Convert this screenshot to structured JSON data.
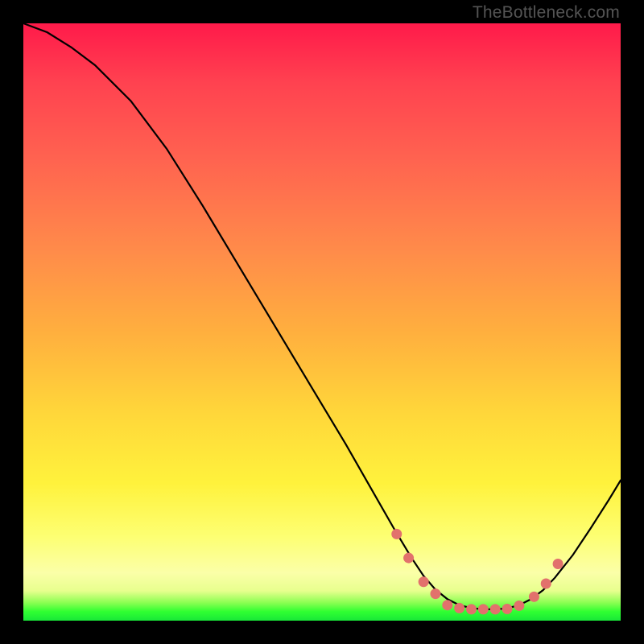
{
  "watermark": "TheBottleneck.com",
  "chart_data": {
    "type": "line",
    "title": "",
    "xlabel": "",
    "ylabel": "",
    "xlim": [
      0,
      100
    ],
    "ylim": [
      0,
      100
    ],
    "grid": false,
    "legend": false,
    "series": [
      {
        "name": "black-curve",
        "stroke": "#000000",
        "stroke_width": 2.2,
        "fill": "none",
        "x": [
          0,
          4,
          8,
          12,
          18,
          24,
          30,
          36,
          42,
          48,
          54,
          58,
          62,
          65,
          67,
          69,
          71,
          73,
          75,
          77,
          79,
          81,
          83,
          85,
          87,
          89,
          92,
          95,
          98,
          100
        ],
        "y": [
          100,
          98.5,
          96,
          93,
          87,
          79,
          69.5,
          59.5,
          49.5,
          39.5,
          29.5,
          22.5,
          15.5,
          10.5,
          7.5,
          5.2,
          3.6,
          2.6,
          2.1,
          1.9,
          1.9,
          2.05,
          2.6,
          3.6,
          5.1,
          7.2,
          11,
          15.5,
          20.2,
          23.5
        ]
      },
      {
        "name": "coral-dots",
        "type": "scatter",
        "stroke": "none",
        "fill": "#e2716c",
        "radius": 6.5,
        "x": [
          62.5,
          64.5,
          67,
          69,
          71,
          73,
          75,
          77,
          79,
          81,
          83,
          85.5,
          87.5,
          89.5
        ],
        "y": [
          14.5,
          10.5,
          6.5,
          4.5,
          2.6,
          2.1,
          1.9,
          1.9,
          1.9,
          1.95,
          2.5,
          4.0,
          6.2,
          9.5
        ]
      }
    ]
  }
}
